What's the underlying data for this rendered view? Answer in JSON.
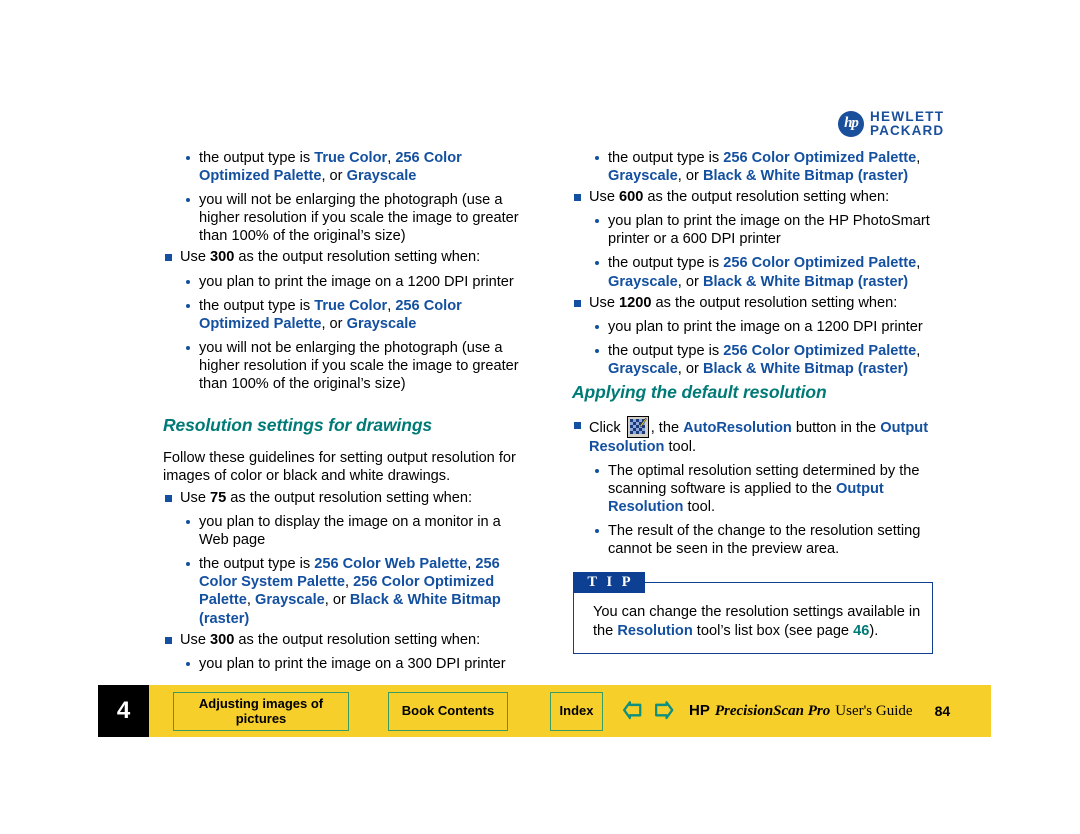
{
  "brand": {
    "logo_mark": "hp",
    "line1": "HEWLETT",
    "line2": "PACKARD"
  },
  "left_column": {
    "items": [
      {
        "type": "round",
        "runs": [
          {
            "t": "the output type is ",
            "s": "plain"
          },
          {
            "t": "True Color",
            "s": "blue"
          },
          {
            "t": ", ",
            "s": "plain"
          },
          {
            "t": "256 Color Optimized Palette",
            "s": "blue"
          },
          {
            "t": ", or ",
            "s": "plain"
          },
          {
            "t": "Grayscale",
            "s": "blue"
          }
        ]
      },
      {
        "type": "round",
        "runs": [
          {
            "t": "you will not be enlarging the photograph (use a higher resolution if you scale the image to greater than 100% of the original’s size)",
            "s": "plain"
          }
        ]
      },
      {
        "type": "square",
        "runs": [
          {
            "t": "Use ",
            "s": "plain"
          },
          {
            "t": "300",
            "s": "kbd"
          },
          {
            "t": " as the output resolution setting when:",
            "s": "plain"
          }
        ]
      },
      {
        "type": "round",
        "runs": [
          {
            "t": "you plan to print the image on a 1200 DPI printer",
            "s": "plain"
          }
        ]
      },
      {
        "type": "round",
        "runs": [
          {
            "t": "the output type is ",
            "s": "plain"
          },
          {
            "t": "True Color",
            "s": "blue"
          },
          {
            "t": ", ",
            "s": "plain"
          },
          {
            "t": "256 Color Optimized Palette",
            "s": "blue"
          },
          {
            "t": ", or ",
            "s": "plain"
          },
          {
            "t": "Grayscale",
            "s": "blue"
          }
        ]
      },
      {
        "type": "round",
        "runs": [
          {
            "t": "you will not be enlarging the photograph (use a higher resolution if you scale the image to greater than 100% of the original’s size)",
            "s": "plain"
          }
        ]
      }
    ],
    "heading": "Resolution settings for drawings",
    "intro": "Follow these guidelines for setting output resolution for images of color or black and white drawings.",
    "items2": [
      {
        "type": "square",
        "runs": [
          {
            "t": "Use ",
            "s": "plain"
          },
          {
            "t": "75",
            "s": "kbd"
          },
          {
            "t": " as the output resolution setting when:",
            "s": "plain"
          }
        ]
      },
      {
        "type": "round",
        "runs": [
          {
            "t": "you plan to display the image on a monitor in a Web page",
            "s": "plain"
          }
        ]
      },
      {
        "type": "round",
        "runs": [
          {
            "t": "the output type is ",
            "s": "plain"
          },
          {
            "t": "256 Color Web Palette",
            "s": "blue"
          },
          {
            "t": ", ",
            "s": "plain"
          },
          {
            "t": "256 Color System Palette",
            "s": "blue"
          },
          {
            "t": ", ",
            "s": "plain"
          },
          {
            "t": "256 Color Optimized Palette",
            "s": "blue"
          },
          {
            "t": ", ",
            "s": "plain"
          },
          {
            "t": "Grayscale",
            "s": "blue"
          },
          {
            "t": ", or ",
            "s": "plain"
          },
          {
            "t": "Black & White Bitmap (raster)",
            "s": "blue"
          }
        ]
      },
      {
        "type": "square",
        "runs": [
          {
            "t": "Use ",
            "s": "plain"
          },
          {
            "t": "300",
            "s": "kbd"
          },
          {
            "t": " as the output resolution setting when:",
            "s": "plain"
          }
        ]
      },
      {
        "type": "round",
        "runs": [
          {
            "t": "you plan to print the image on a 300 DPI printer",
            "s": "plain"
          }
        ]
      }
    ]
  },
  "right_column": {
    "items": [
      {
        "type": "round",
        "runs": [
          {
            "t": "the output type is ",
            "s": "plain"
          },
          {
            "t": "256 Color Optimized Palette",
            "s": "blue"
          },
          {
            "t": ", ",
            "s": "plain"
          },
          {
            "t": "Grayscale",
            "s": "blue"
          },
          {
            "t": ", or ",
            "s": "plain"
          },
          {
            "t": "Black & White Bitmap (raster)",
            "s": "blue"
          }
        ]
      },
      {
        "type": "square",
        "runs": [
          {
            "t": "Use ",
            "s": "plain"
          },
          {
            "t": "600",
            "s": "kbd"
          },
          {
            "t": " as the output resolution setting when:",
            "s": "plain"
          }
        ]
      },
      {
        "type": "round",
        "runs": [
          {
            "t": "you plan to print the image on the HP PhotoSmart printer or a 600 DPI printer",
            "s": "plain"
          }
        ]
      },
      {
        "type": "round",
        "runs": [
          {
            "t": "the output type is ",
            "s": "plain"
          },
          {
            "t": "256 Color Optimized Palette",
            "s": "blue"
          },
          {
            "t": ", ",
            "s": "plain"
          },
          {
            "t": "Grayscale",
            "s": "blue"
          },
          {
            "t": ", or ",
            "s": "plain"
          },
          {
            "t": "Black & White Bitmap (raster)",
            "s": "blue"
          }
        ]
      },
      {
        "type": "square",
        "runs": [
          {
            "t": "Use ",
            "s": "plain"
          },
          {
            "t": "1200",
            "s": "kbd"
          },
          {
            "t": " as the output resolution setting when:",
            "s": "plain"
          }
        ]
      },
      {
        "type": "round",
        "runs": [
          {
            "t": "you plan to print the image on a 1200 DPI printer",
            "s": "plain"
          }
        ]
      },
      {
        "type": "round",
        "runs": [
          {
            "t": "the output type is ",
            "s": "plain"
          },
          {
            "t": "256 Color Optimized Palette",
            "s": "blue"
          },
          {
            "t": ", ",
            "s": "plain"
          },
          {
            "t": "Grayscale",
            "s": "blue"
          },
          {
            "t": ", or ",
            "s": "plain"
          },
          {
            "t": "Black & White Bitmap (raster)",
            "s": "blue"
          }
        ]
      }
    ],
    "heading": "Applying the default resolution",
    "items2": [
      {
        "type": "square",
        "icon": "autoresolution-icon",
        "runs": [
          {
            "t": "Click ",
            "s": "plain"
          },
          {
            "t": "__ICON__",
            "s": "icon"
          },
          {
            "t": ", the ",
            "s": "plain"
          },
          {
            "t": "AutoResolution",
            "s": "blue"
          },
          {
            "t": " button in the ",
            "s": "plain"
          },
          {
            "t": "Output Resolution",
            "s": "blue"
          },
          {
            "t": " tool.",
            "s": "plain"
          }
        ]
      },
      {
        "type": "round",
        "runs": [
          {
            "t": "The optimal resolution setting determined by the scanning software is applied to the ",
            "s": "plain"
          },
          {
            "t": "Output Resolution",
            "s": "blue"
          },
          {
            "t": " tool.",
            "s": "plain"
          }
        ]
      },
      {
        "type": "round",
        "runs": [
          {
            "t": "The result of the change to the resolution setting cannot be seen in the preview area.",
            "s": "plain"
          }
        ]
      }
    ]
  },
  "tip": {
    "label": "T I P",
    "runs": [
      {
        "t": "You can change the resolution settings available in the ",
        "s": "plain"
      },
      {
        "t": "Resolution",
        "s": "blue"
      },
      {
        "t": " tool’s list box (see page ",
        "s": "plain"
      },
      {
        "t": "46",
        "s": "page"
      },
      {
        "t": ").",
        "s": "plain"
      }
    ]
  },
  "footer": {
    "chapter_number": "4",
    "chapter_button": "Adjusting images of pictures",
    "contents_button": "Book Contents",
    "index_button": "Index",
    "back_arrow": "left-arrow-icon",
    "forward_arrow": "right-arrow-icon",
    "guide_hp": "HP",
    "guide_product": "PrecisionScan Pro",
    "guide_suffix": "User's Guide",
    "page_number": "84"
  },
  "colors": {
    "heading_teal": "#007a76",
    "link_blue": "#1450a0",
    "footer_yellow": "#f6cf2b",
    "button_green": "#3a9c62",
    "tip_blue": "#0d3f92"
  }
}
